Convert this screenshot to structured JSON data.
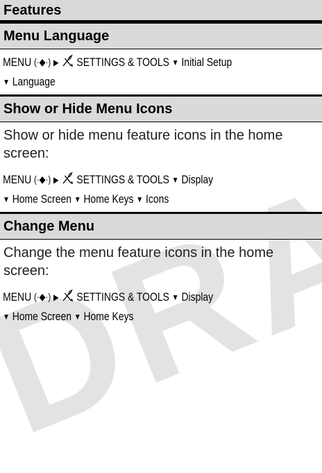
{
  "watermark": "DRAFT",
  "table": {
    "header": "Features"
  },
  "sections": [
    {
      "title": "Menu Language",
      "description": "",
      "path": {
        "menu": "MENU",
        "settings": "SETTINGS & TOOLS",
        "line1_end": "Initial Setup",
        "line2": [
          "Language"
        ]
      }
    },
    {
      "title": "Show or Hide Menu Icons",
      "description": "Show or hide menu feature icons in the home screen:",
      "path": {
        "menu": "MENU",
        "settings": "SETTINGS & TOOLS",
        "line1_end": "Display",
        "line2": [
          "Home Screen",
          "Home Keys",
          "Icons"
        ]
      }
    },
    {
      "title": "Change Menu",
      "description": "Change the menu feature icons in the home screen:",
      "path": {
        "menu": "MENU",
        "settings": "SETTINGS & TOOLS",
        "line1_end": "Display",
        "line2": [
          "Home Screen",
          "Home Keys"
        ]
      }
    }
  ]
}
